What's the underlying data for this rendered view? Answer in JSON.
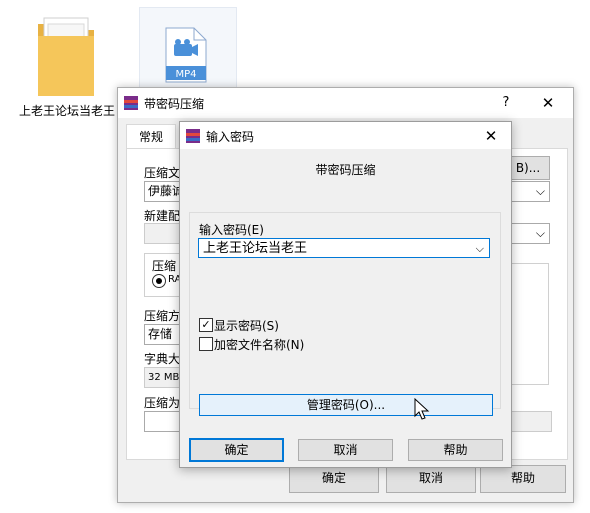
{
  "desktop": {
    "folder_label": "上老王论坛当老王",
    "mp4_label": "MP4"
  },
  "main_dialog": {
    "title": "带密码压缩",
    "help_glyph": "?",
    "close_glyph": "✕",
    "tab_general": "常规",
    "archive_name_label": "压缩文",
    "archive_name_value": "伊藤诚",
    "browse_button": "B)...",
    "update_mode_label": "新建配",
    "format_group_label": "压缩",
    "format_radio_label": "RA",
    "method_label": "压缩方",
    "method_value": "存储",
    "dict_label": "字典大",
    "dict_value": "32 MB",
    "split_label": "压缩为",
    "ok_button": "确定",
    "cancel_button": "取消",
    "help_button": "帮助"
  },
  "password_dialog": {
    "title": "输入密码",
    "close_glyph": "✕",
    "heading": "带密码压缩",
    "enter_password_label": "输入密码(E)",
    "password_value": "上老王论坛当老王",
    "show_password_label": "显示密码(S)",
    "show_password_checked": true,
    "encrypt_filenames_label": "加密文件名称(N)",
    "encrypt_filenames_checked": false,
    "manage_passwords_button": "管理密码(O)...",
    "ok_button": "确定",
    "cancel_button": "取消",
    "help_button": "帮助"
  },
  "colors": {
    "accent": "#0078d7",
    "window_bg": "#f0f0f0",
    "button_bg": "#e1e1e1",
    "folder_yellow": "#f5c65a",
    "mp4_blue": "#4a90d9"
  }
}
